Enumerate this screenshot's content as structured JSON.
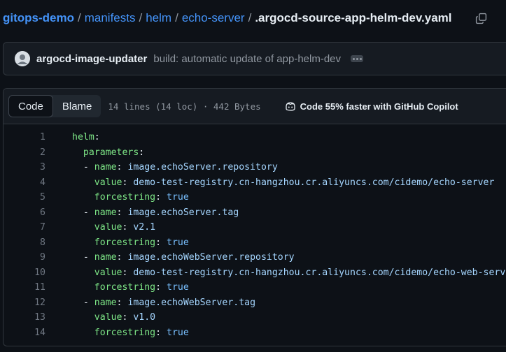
{
  "breadcrumb": {
    "repo": "gitops-demo",
    "parts": [
      "manifests",
      "helm",
      "echo-server"
    ],
    "separator": "/",
    "file": ".argocd-source-app-helm-dev.yaml"
  },
  "commit": {
    "author": "argocd-image-updater",
    "message": "build: automatic update of app-helm-dev"
  },
  "file_header": {
    "tab_code": "Code",
    "tab_blame": "Blame",
    "meta": "14 lines (14 loc) · 442 Bytes",
    "copilot": "Code 55% faster with GitHub Copilot"
  },
  "code": [
    {
      "n": "1",
      "indent": "",
      "dash": "",
      "key": "helm",
      "colon": ":",
      "value": "",
      "vtype": ""
    },
    {
      "n": "2",
      "indent": "  ",
      "dash": "",
      "key": "parameters",
      "colon": ":",
      "value": "",
      "vtype": ""
    },
    {
      "n": "3",
      "indent": "  ",
      "dash": "- ",
      "key": "name",
      "colon": ": ",
      "value": "image.echoServer.repository",
      "vtype": "s"
    },
    {
      "n": "4",
      "indent": "    ",
      "dash": "",
      "key": "value",
      "colon": ": ",
      "value": "demo-test-registry.cn-hangzhou.cr.aliyuncs.com/cidemo/echo-server",
      "vtype": "s"
    },
    {
      "n": "5",
      "indent": "    ",
      "dash": "",
      "key": "forcestring",
      "colon": ": ",
      "value": "true",
      "vtype": "c"
    },
    {
      "n": "6",
      "indent": "  ",
      "dash": "- ",
      "key": "name",
      "colon": ": ",
      "value": "image.echoServer.tag",
      "vtype": "s"
    },
    {
      "n": "7",
      "indent": "    ",
      "dash": "",
      "key": "value",
      "colon": ": ",
      "value": "v2.1",
      "vtype": "s"
    },
    {
      "n": "8",
      "indent": "    ",
      "dash": "",
      "key": "forcestring",
      "colon": ": ",
      "value": "true",
      "vtype": "c"
    },
    {
      "n": "9",
      "indent": "  ",
      "dash": "- ",
      "key": "name",
      "colon": ": ",
      "value": "image.echoWebServer.repository",
      "vtype": "s"
    },
    {
      "n": "10",
      "indent": "    ",
      "dash": "",
      "key": "value",
      "colon": ": ",
      "value": "demo-test-registry.cn-hangzhou.cr.aliyuncs.com/cidemo/echo-web-server",
      "vtype": "s"
    },
    {
      "n": "11",
      "indent": "    ",
      "dash": "",
      "key": "forcestring",
      "colon": ": ",
      "value": "true",
      "vtype": "c"
    },
    {
      "n": "12",
      "indent": "  ",
      "dash": "- ",
      "key": "name",
      "colon": ": ",
      "value": "image.echoWebServer.tag",
      "vtype": "s"
    },
    {
      "n": "13",
      "indent": "    ",
      "dash": "",
      "key": "value",
      "colon": ": ",
      "value": "v1.0",
      "vtype": "s"
    },
    {
      "n": "14",
      "indent": "    ",
      "dash": "",
      "key": "forcestring",
      "colon": ": ",
      "value": "true",
      "vtype": "c"
    }
  ]
}
